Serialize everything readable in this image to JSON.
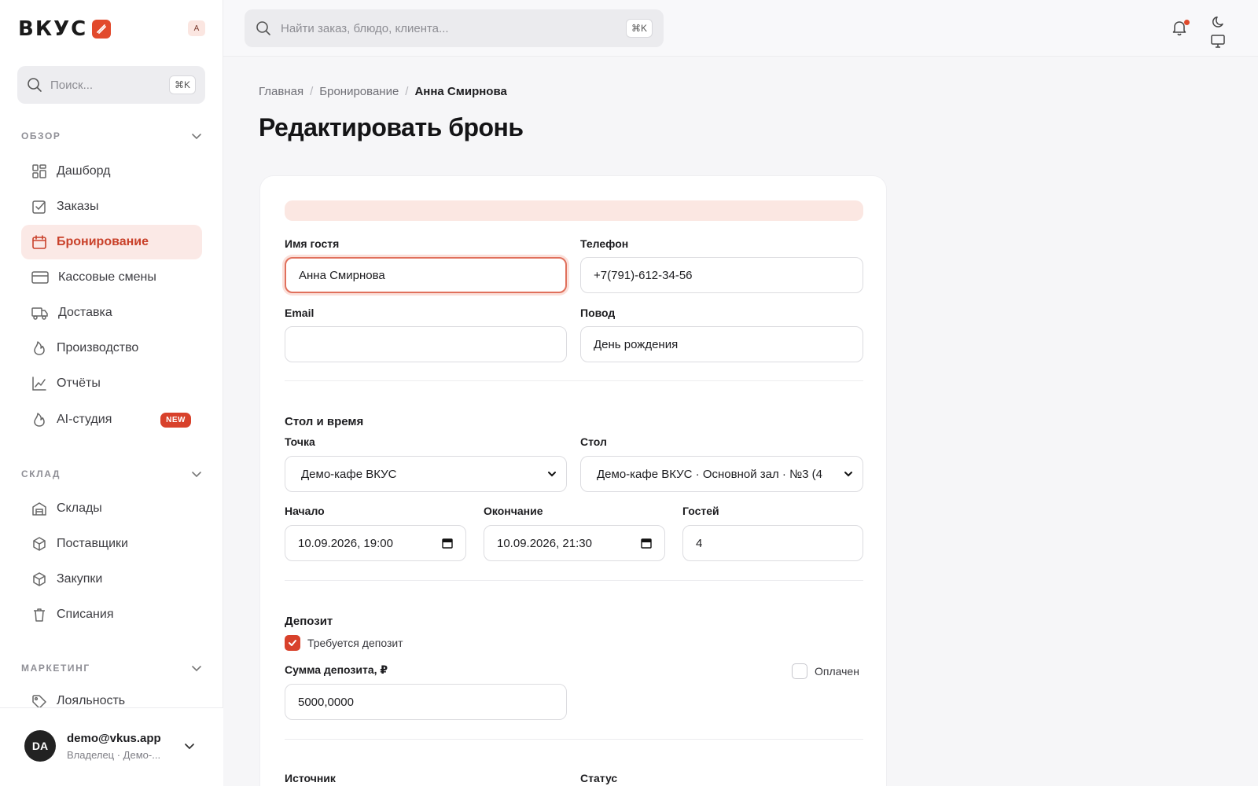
{
  "brand": {
    "name": "ВКУС",
    "mini_avatar": "A",
    "accent": "#d8412b"
  },
  "sidebar": {
    "search": {
      "placeholder": "Поиск...",
      "shortcut": "⌘K"
    },
    "sections": [
      {
        "title": "ОБЗОР",
        "items": [
          {
            "label": "Дашборд",
            "icon": "grid-icon"
          },
          {
            "label": "Заказы",
            "icon": "checklist-icon"
          },
          {
            "label": "Бронирование",
            "icon": "calendar-icon",
            "active": true
          },
          {
            "label": "Кассовые смены",
            "icon": "card-icon"
          },
          {
            "label": "Доставка",
            "icon": "truck-icon"
          },
          {
            "label": "Производство",
            "icon": "flame-icon"
          },
          {
            "label": "Отчёты",
            "icon": "chart-icon"
          },
          {
            "label": "AI-студия",
            "icon": "flame-icon",
            "badge": "NEW"
          }
        ]
      },
      {
        "title": "СКЛАД",
        "items": [
          {
            "label": "Склады",
            "icon": "warehouse-icon"
          },
          {
            "label": "Поставщики",
            "icon": "box-icon"
          },
          {
            "label": "Закупки",
            "icon": "box-icon"
          },
          {
            "label": "Списания",
            "icon": "trash-icon"
          }
        ]
      },
      {
        "title": "МАРКЕТИНГ",
        "items": [
          {
            "label": "Лояльность",
            "icon": "tag-icon"
          }
        ]
      }
    ],
    "user": {
      "initials": "DA",
      "email": "demo@vkus.app",
      "role": "Владелец · Демо-..."
    }
  },
  "topbar": {
    "search_placeholder": "Найти заказ, блюдо, клиента...",
    "shortcut": "⌘K"
  },
  "breadcrumbs": [
    "Главная",
    "Бронирование",
    "Анна Смирнова"
  ],
  "page_title": "Редактировать бронь",
  "form": {
    "guest_name": {
      "label": "Имя гостя",
      "value": "Анна Смирнова"
    },
    "phone": {
      "label": "Телефон",
      "value": "+7(791)-612-34-56"
    },
    "email": {
      "label": "Email",
      "value": ""
    },
    "occasion": {
      "label": "Повод",
      "value": "День рождения"
    },
    "table_section": "Стол и время",
    "point": {
      "label": "Точка",
      "value": "Демо-кафе ВКУС"
    },
    "table": {
      "label": "Стол",
      "value": "Демо-кафе ВКУС · Основной зал · №3 (4"
    },
    "start": {
      "label": "Начало",
      "value": "10.09.2026, 19:00"
    },
    "end": {
      "label": "Окончание",
      "value": "10.09.2026, 21:30"
    },
    "guests": {
      "label": "Гостей",
      "value": "4"
    },
    "deposit_section": "Депозит",
    "deposit_required": {
      "label": "Требуется депозит",
      "checked": true
    },
    "deposit_amount": {
      "label": "Сумма депозита, ₽",
      "value": "5000,0000"
    },
    "paid": {
      "label": "Оплачен",
      "checked": false
    },
    "source": {
      "label": "Источник"
    },
    "status": {
      "label": "Статус"
    }
  }
}
